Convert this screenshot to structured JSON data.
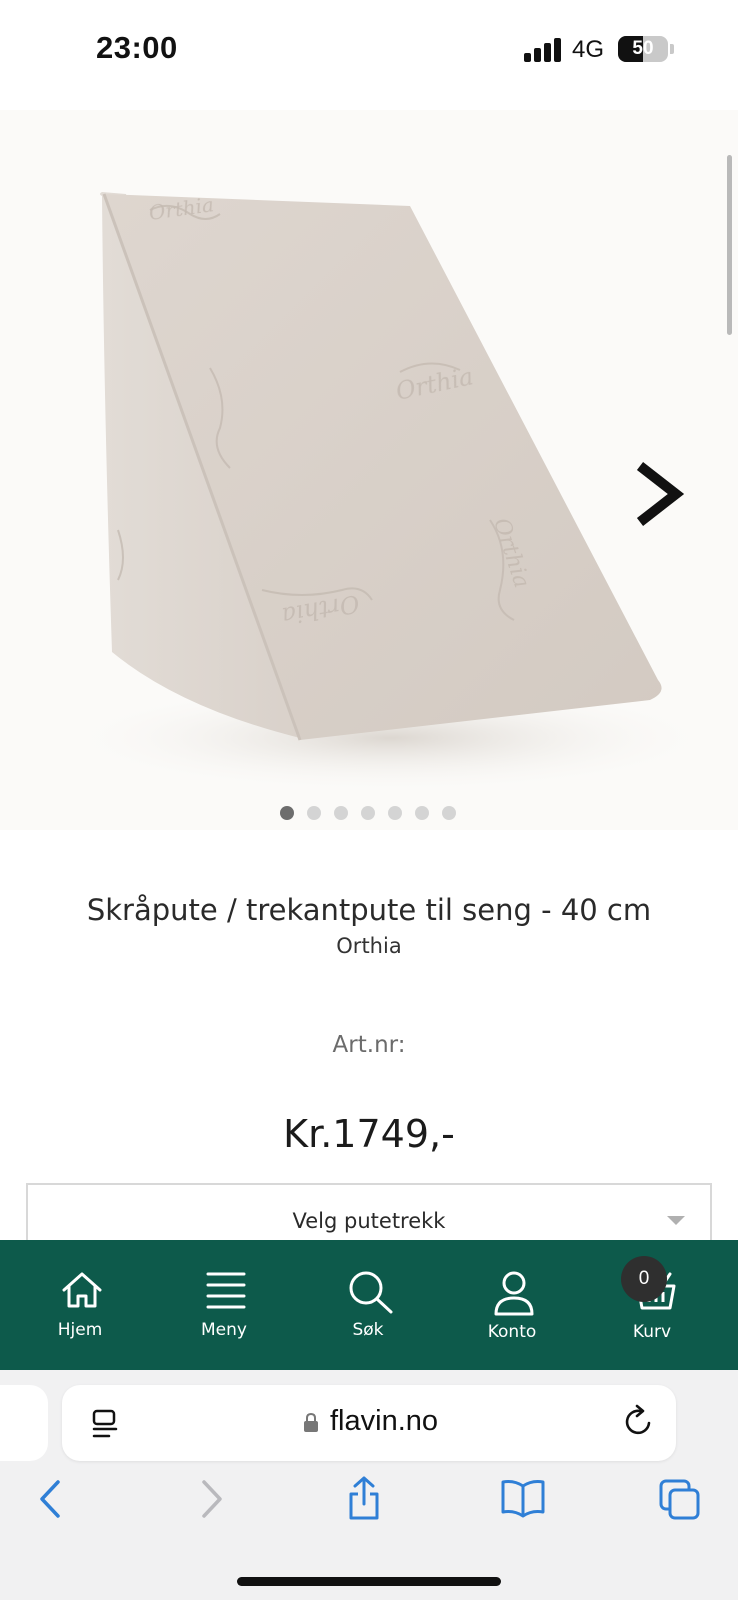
{
  "status_bar": {
    "time": "23:00",
    "network": "4G",
    "battery_level": "50",
    "battery_fraction": 0.5
  },
  "gallery": {
    "image": "wedge-pillow-product-photo",
    "logo_text": "Orthia",
    "dots_total": 7,
    "active_index": 0
  },
  "product": {
    "title": "Skråpute / trekantpute til seng - 40 cm",
    "brand": "Orthia",
    "artnr_label": "Art.nr:",
    "price": "Kr.1749,-",
    "select_label": "Velg putetrekk"
  },
  "nav": {
    "items": [
      {
        "label": "Hjem",
        "icon": "home-icon"
      },
      {
        "label": "Meny",
        "icon": "menu-icon"
      },
      {
        "label": "Søk",
        "icon": "search-icon"
      },
      {
        "label": "Konto",
        "icon": "account-icon"
      },
      {
        "label": "Kurv",
        "icon": "basket-icon"
      }
    ],
    "cart_count": "0"
  },
  "browser": {
    "url": "flavin.no"
  },
  "colors": {
    "nav_bg": "#0d5a4b",
    "browser_accent": "#2f7fd6",
    "badge_bg": "#2f2f2f"
  }
}
